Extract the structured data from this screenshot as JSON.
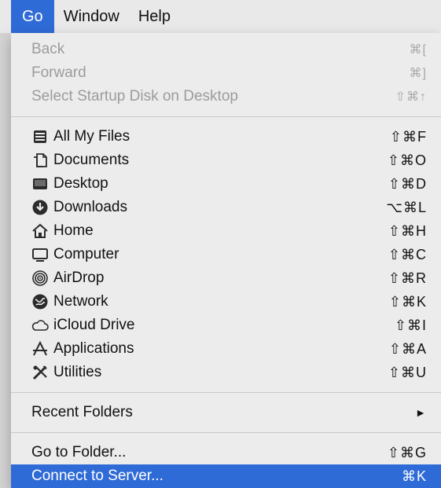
{
  "menubar": {
    "items": [
      {
        "label": "Go"
      },
      {
        "label": "Window"
      },
      {
        "label": "Help"
      }
    ]
  },
  "menu": {
    "nav": [
      {
        "label": "Back",
        "shortcut": "⌘[",
        "enabled": false
      },
      {
        "label": "Forward",
        "shortcut": "⌘]",
        "enabled": false
      },
      {
        "label": "Select Startup Disk on Desktop",
        "shortcut": "⇧⌘↑",
        "enabled": false
      }
    ],
    "places": [
      {
        "label": "All My Files",
        "shortcut": "⇧⌘F",
        "icon": "all-files-icon"
      },
      {
        "label": "Documents",
        "shortcut": "⇧⌘O",
        "icon": "documents-icon"
      },
      {
        "label": "Desktop",
        "shortcut": "⇧⌘D",
        "icon": "desktop-icon"
      },
      {
        "label": "Downloads",
        "shortcut": "⌥⌘L",
        "icon": "downloads-icon"
      },
      {
        "label": "Home",
        "shortcut": "⇧⌘H",
        "icon": "home-icon"
      },
      {
        "label": "Computer",
        "shortcut": "⇧⌘C",
        "icon": "computer-icon"
      },
      {
        "label": "AirDrop",
        "shortcut": "⇧⌘R",
        "icon": "airdrop-icon"
      },
      {
        "label": "Network",
        "shortcut": "⇧⌘K",
        "icon": "network-icon"
      },
      {
        "label": "iCloud Drive",
        "shortcut": "⇧⌘I",
        "icon": "icloud-icon"
      },
      {
        "label": "Applications",
        "shortcut": "⇧⌘A",
        "icon": "applications-icon"
      },
      {
        "label": "Utilities",
        "shortcut": "⇧⌘U",
        "icon": "utilities-icon"
      }
    ],
    "recent_folders": {
      "label": "Recent Folders",
      "arrow": "►"
    },
    "go_to_folder": {
      "label": "Go to Folder...",
      "shortcut": "⇧⌘G"
    },
    "connect_to_server": {
      "label": "Connect to Server...",
      "shortcut": "⌘K"
    }
  },
  "colors": {
    "highlight": "#2f6bd6",
    "menu_bg": "#ececec",
    "disabled_text": "#9c9c9c"
  }
}
